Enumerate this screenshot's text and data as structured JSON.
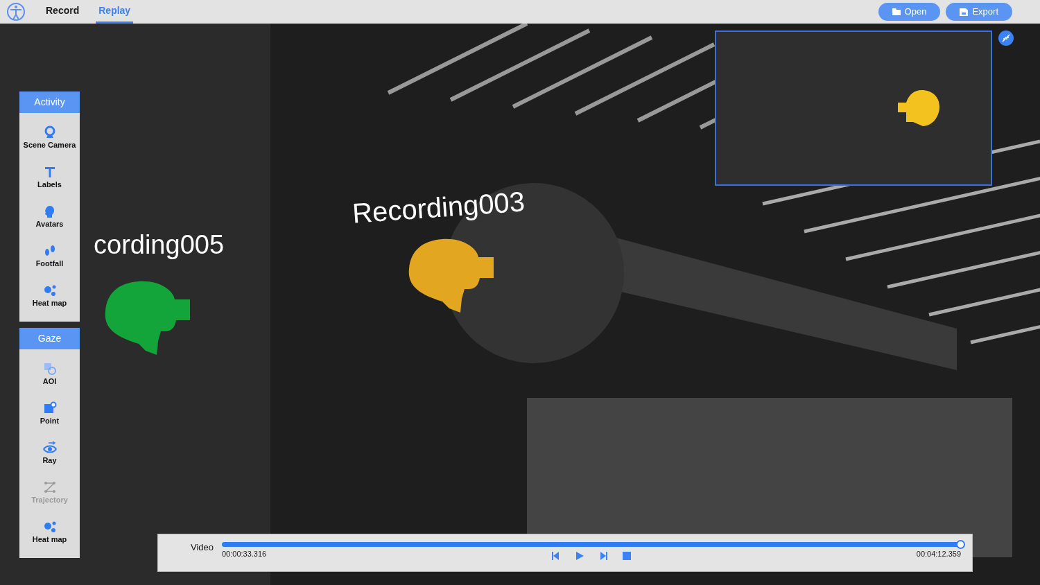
{
  "tabs": [
    {
      "label": "Record",
      "selected": false
    },
    {
      "label": "Replay",
      "selected": true
    }
  ],
  "buttons": [
    {
      "label": "Open"
    },
    {
      "label": "Export"
    }
  ],
  "panels": [
    {
      "title": "Activity",
      "items": [
        {
          "label": "Scene Camera",
          "disabled": false
        },
        {
          "label": "Labels",
          "disabled": false
        },
        {
          "label": "Avatars",
          "disabled": false
        },
        {
          "label": "Footfall",
          "disabled": false
        },
        {
          "label": "Heat map",
          "disabled": false
        }
      ]
    },
    {
      "title": "Gaze",
      "items": [
        {
          "label": "AOI",
          "disabled": false
        },
        {
          "label": "Point",
          "disabled": false
        },
        {
          "label": "Ray",
          "disabled": false
        },
        {
          "label": "Trajectory",
          "disabled": true
        },
        {
          "label": "Heat map",
          "disabled": false
        }
      ]
    }
  ],
  "scene": {
    "avatars": [
      {
        "name": "cording005",
        "color": "#14a53a"
      },
      {
        "name": "Recording003",
        "color": "#e2a621"
      }
    ]
  },
  "video": {
    "label": "Video",
    "level": 1,
    "start": "00:00:33.316",
    "end": "00:04:12.359"
  }
}
